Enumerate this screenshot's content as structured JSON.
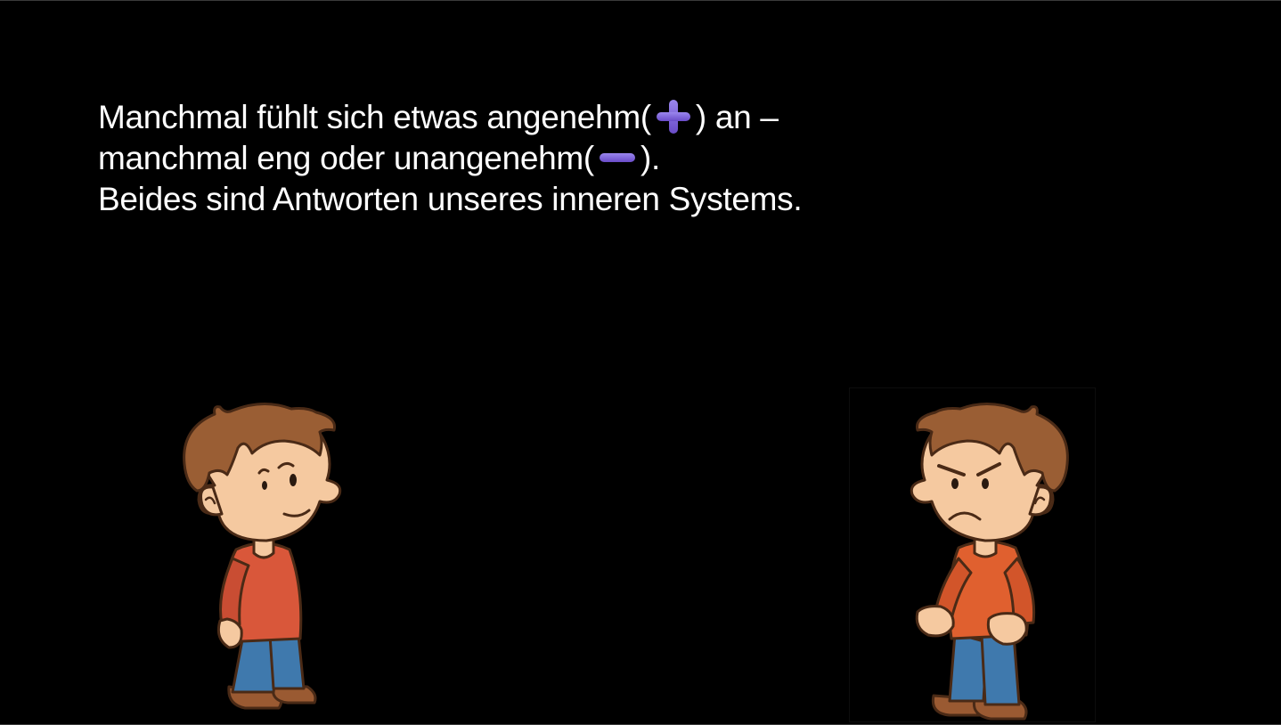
{
  "slide": {
    "line1_before": "Manchmal fühlt sich etwas angenehm(",
    "line1_after": ") an –",
    "line2_before": "manchmal eng oder unangenehm(",
    "line2_after": ").",
    "line3": "Beides sind Antworten unseres inneren Systems.",
    "plus_icon": "heavy-plus-sign-icon",
    "minus_icon": "heavy-minus-sign-icon",
    "icon_color": "#7b5fd6"
  },
  "figures": {
    "left": "happy-boy-illustration",
    "right": "angry-boy-illustration"
  }
}
